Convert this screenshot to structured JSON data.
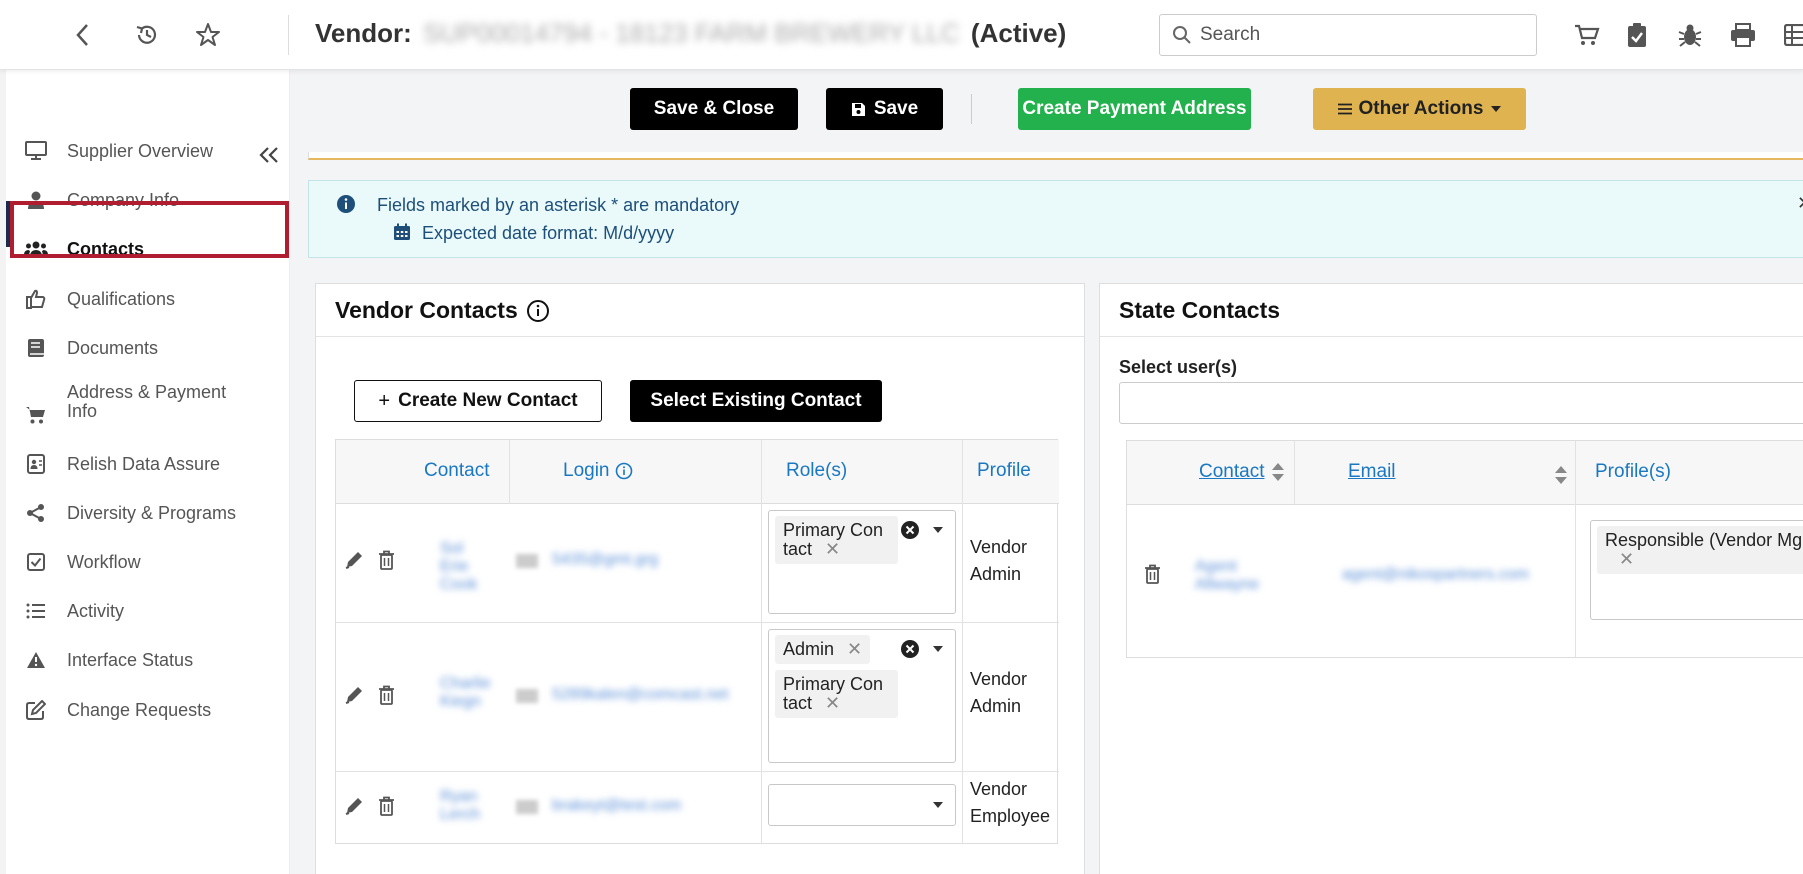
{
  "topbar": {
    "title_prefix": "Vendor:",
    "title_redacted": "SUP00014794 - 18123 FARM BREWERY LLC",
    "title_status": "(Active)",
    "search_placeholder": "Search"
  },
  "sidebar": {
    "items": [
      {
        "label": "Supplier Overview",
        "icon": "monitor-icon"
      },
      {
        "label": "Company Info",
        "icon": "user-icon"
      },
      {
        "label": "Contacts",
        "icon": "users-icon",
        "active": true
      },
      {
        "label": "Qualifications",
        "icon": "thumbs-up-icon"
      },
      {
        "label": "Documents",
        "icon": "book-icon"
      },
      {
        "label": "Address & Payment Info",
        "icon": "cart-icon"
      },
      {
        "label": "Relish Data Assure",
        "icon": "id-card-icon"
      },
      {
        "label": "Diversity & Programs",
        "icon": "share-icon"
      },
      {
        "label": "Workflow",
        "icon": "check-square-icon"
      },
      {
        "label": "Activity",
        "icon": "list-icon"
      },
      {
        "label": "Interface Status",
        "icon": "warning-icon"
      },
      {
        "label": "Change Requests",
        "icon": "edit-icon"
      }
    ]
  },
  "toolbar": {
    "save_close": "Save & Close",
    "save": "Save",
    "create_payment_address": "Create Payment Address",
    "other_actions": "Other Actions"
  },
  "info": {
    "line1": "Fields marked by an asterisk * are mandatory",
    "line2": "Expected date format: M/d/yyyy"
  },
  "vendor_contacts": {
    "title": "Vendor Contacts",
    "create_new": "Create New Contact",
    "select_existing": "Select Existing Contact",
    "columns": {
      "contact": "Contact",
      "login": "Login",
      "roles": "Role(s)",
      "profile": "Profile"
    },
    "rows": [
      {
        "contact": "Sol Erie Cook",
        "login": "5435@gmt.grg",
        "roles": [
          "Primary Con tact"
        ],
        "profile": "Vendor Admin"
      },
      {
        "contact": "Charlie Kiegn",
        "login": "5289kalen@comcast.net",
        "roles": [
          "Admin",
          "Primary Con tact"
        ],
        "profile": "Vendor Admin"
      },
      {
        "contact": "Ryan Lerch",
        "login": "brakeyt@test.com",
        "roles": [],
        "profile": "Vendor Employee"
      }
    ]
  },
  "state_contacts": {
    "title": "State Contacts",
    "select_label": "Select user(s)",
    "columns": {
      "contact": "Contact",
      "email": "Email",
      "profiles": "Profile(s)"
    },
    "rows": [
      {
        "contact": "Agent Allwayne",
        "email": "agent@nikospartners.com",
        "profile_tag": "Responsible (Vendor Mg"
      }
    ]
  }
}
